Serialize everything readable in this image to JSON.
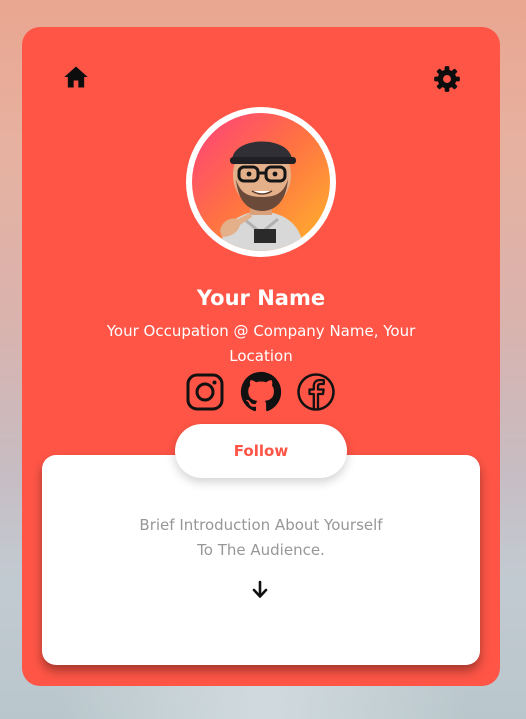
{
  "profile": {
    "name": "Your Name",
    "occupation": "Your Occupation @ Company Name, Your Location",
    "follow_label": "Follow",
    "intro": "Brief Introduction About Yourself To The Audience."
  },
  "icons": {
    "top_left": "home-icon",
    "top_right": "gear-icon",
    "social": [
      "instagram-icon",
      "github-icon",
      "facebook-icon"
    ],
    "scroll": "arrow-down-icon"
  },
  "colors": {
    "card": "#fe5546",
    "text_on_card": "#ffffff",
    "intro_text": "#979797"
  }
}
